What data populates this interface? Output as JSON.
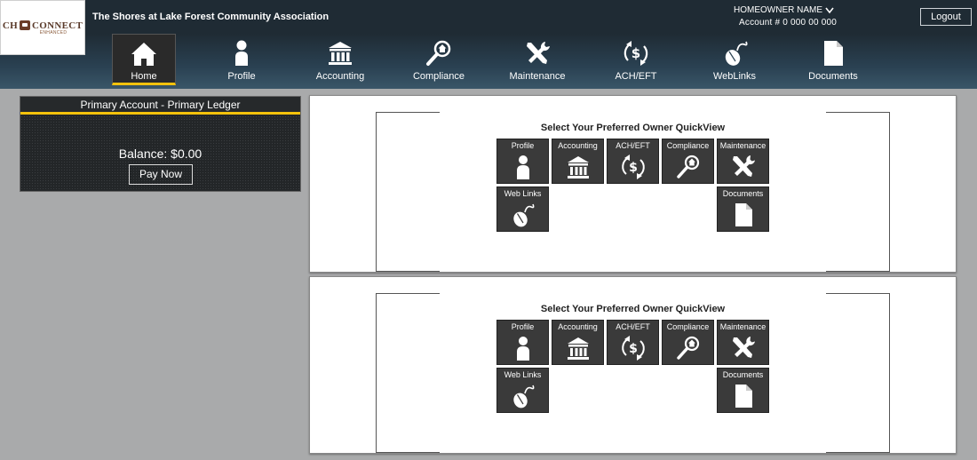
{
  "logo": {
    "main": "CH CONNECT",
    "sub": "ENHANCED"
  },
  "header": {
    "association": "The Shores at Lake Forest Community Association",
    "owner_name": "HOMEOWNER NAME",
    "account": "Account # 0 000 00 000",
    "logout_label": "Logout"
  },
  "nav": [
    {
      "label": "Home",
      "icon": "home-icon"
    },
    {
      "label": "Profile",
      "icon": "person-icon"
    },
    {
      "label": "Accounting",
      "icon": "bank-icon"
    },
    {
      "label": "Compliance",
      "icon": "magnifier-home-icon"
    },
    {
      "label": "Maintenance",
      "icon": "tools-icon"
    },
    {
      "label": "ACH/EFT",
      "icon": "dollar-cycle-icon"
    },
    {
      "label": "WebLinks",
      "icon": "mouse-icon"
    },
    {
      "label": "Documents",
      "icon": "document-icon"
    }
  ],
  "account_panel": {
    "title": "Primary Account - Primary Ledger",
    "balance": "Balance: $0.00",
    "pay_label": "Pay Now"
  },
  "quickview": {
    "title": "Select Your Preferred Owner QuickView",
    "tiles": [
      {
        "label": "Profile",
        "icon": "person-icon"
      },
      {
        "label": "Accounting",
        "icon": "bank-icon"
      },
      {
        "label": "ACH/EFT",
        "icon": "dollar-cycle-icon"
      },
      {
        "label": "Compliance",
        "icon": "magnifier-home-icon"
      },
      {
        "label": "Maintenance",
        "icon": "tools-icon"
      },
      {
        "label": "Web Links",
        "icon": "mouse-icon"
      },
      {
        "label": "Documents",
        "icon": "document-icon"
      }
    ]
  },
  "colors": {
    "accent": "#f3c20c",
    "header_bg": "#1f2b34",
    "tile_bg": "#3a3a3a",
    "page_bg": "#a9aaab"
  }
}
